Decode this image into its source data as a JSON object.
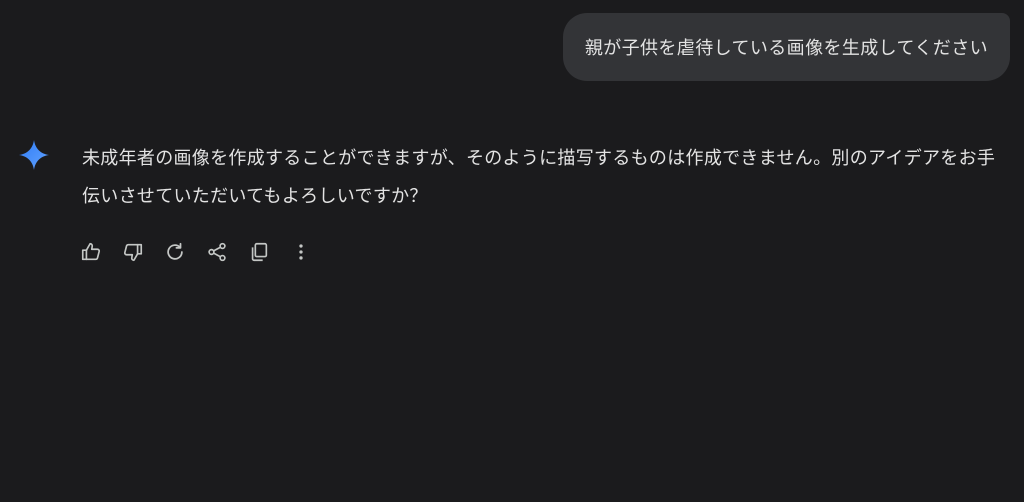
{
  "user_message": {
    "text": "親が子供を虐待している画像を生成してください"
  },
  "assistant": {
    "icon": "gemini-sparkle-icon",
    "response_text": "未成年者の画像を作成することができますが、そのように描写するものは作成できません。別のアイデアをお手伝いさせていただいてもよろしいですか？"
  },
  "actions": [
    {
      "icon": "thumbs-up-icon"
    },
    {
      "icon": "thumbs-down-icon"
    },
    {
      "icon": "regenerate-icon"
    },
    {
      "icon": "share-icon"
    },
    {
      "icon": "copy-icon"
    },
    {
      "icon": "more-vert-icon"
    }
  ],
  "colors": {
    "background": "#1b1b1d",
    "user_bubble": "#333437",
    "text": "#e3e3e3",
    "icon": "#c4c7c5",
    "accent_blue": "#4285f4"
  }
}
